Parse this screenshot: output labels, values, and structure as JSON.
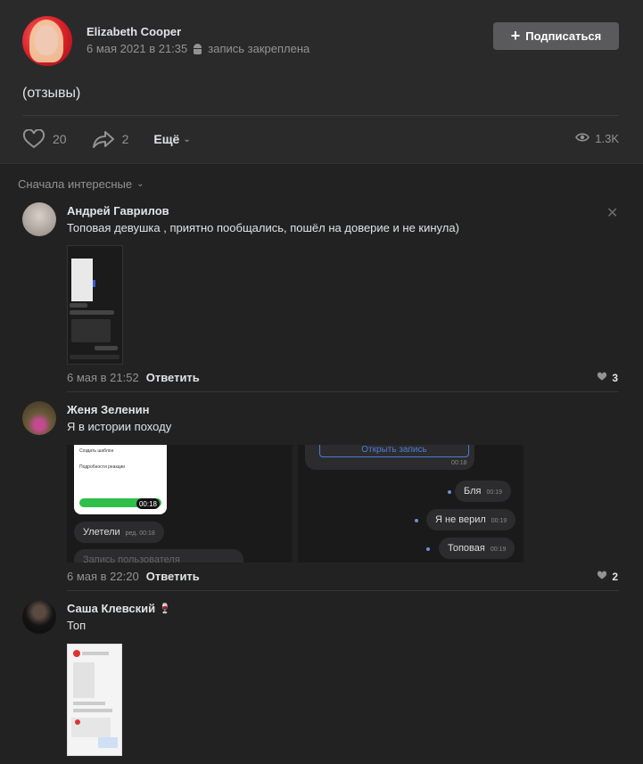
{
  "post": {
    "author": "Elizabeth Cooper",
    "date": "6 мая 2021 в 21:35",
    "pinned": "запись закреплена",
    "subscribe_label": "Подписаться",
    "text": "(отзывы)",
    "likes": "20",
    "shares": "2",
    "more_label": "Ещё",
    "views": "1.3K"
  },
  "sort_label": "Сначала интересные",
  "comments": [
    {
      "author": "Андрей Гаврилов",
      "text": "Топовая девушка , приятно пообщались, пошёл на доверие и не кинула)",
      "date": "6 мая в 21:52",
      "reply": "Ответить",
      "likes": "3"
    },
    {
      "author": "Женя Зеленин",
      "text": "Я в истории походу",
      "date": "6 мая в 22:20",
      "reply": "Ответить",
      "likes": "2",
      "shot_left": {
        "card_title": "Создать шаблон",
        "card_line": "Подробности реакции",
        "time": "00:18",
        "bubble": "Улетели",
        "bubble_meta": "ред. 00:18",
        "bubble2": "Запись пользователя"
      },
      "shot_right": {
        "open_label": "Открыть запись",
        "open_time": "00:18",
        "msgs": [
          {
            "text": "Бля",
            "time": "00:19"
          },
          {
            "text": "Я не верил",
            "time": "00:19"
          },
          {
            "text": "Топовая",
            "time": "00:19"
          }
        ]
      }
    },
    {
      "author": "Саша Клевский",
      "emoji": "🍷",
      "text": "Топ"
    }
  ]
}
